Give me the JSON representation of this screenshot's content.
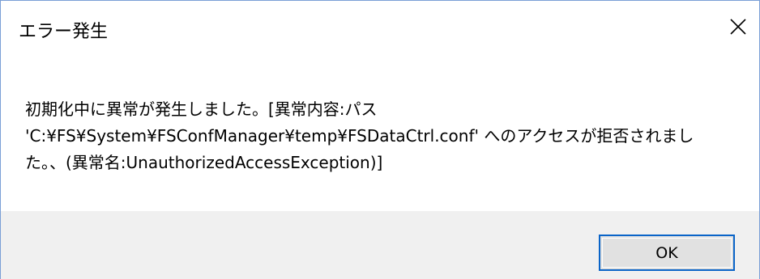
{
  "dialog": {
    "title": "エラー発生",
    "close_icon": "close-icon",
    "message_lines": [
      "初期化中に異常が発生しました。[異常内容:パス",
      "'C:¥FS¥System¥FSConfManager¥temp¥FSDataCtrl.conf' へのアクセスが拒否されまし",
      "た。、(異常名:UnauthorizedAccessException)]"
    ],
    "ok_label": "OK"
  },
  "colors": {
    "footer_bg": "#f0f0f0",
    "ok_border": "#0a64c8",
    "ok_bg": "#e1e1e1",
    "window_border": "#7a9fd6"
  }
}
